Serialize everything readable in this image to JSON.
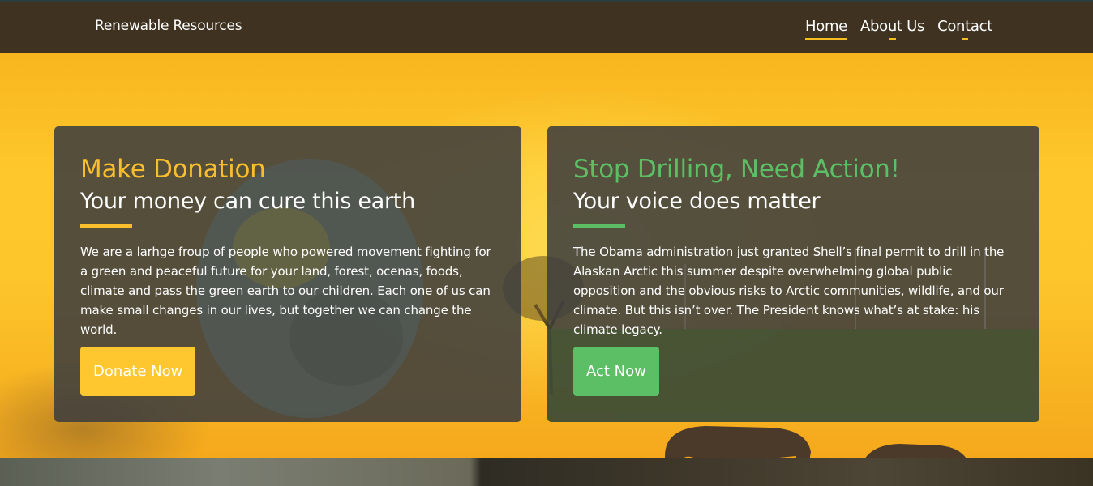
{
  "nav": {
    "brand": "Renewable Resources",
    "links": [
      {
        "label": "Home",
        "active": true
      },
      {
        "label": "About Us",
        "active": false
      },
      {
        "label": "Contact",
        "active": false
      }
    ]
  },
  "cards": {
    "donation": {
      "title": "Make Donation",
      "subtitle": "Your money can cure this earth",
      "body": "We are a larhge froup of people who powered movement fighting for a green and peaceful future for your land, forest, ocenas, foods, climate and pass the green earth to our children. Each one of us can make small changes in our lives, but together we can change the world.",
      "button": "Donate Now"
    },
    "drilling": {
      "title": "Stop Drilling, Need Action!",
      "subtitle": "Your voice does matter",
      "body": "The Obama administration just granted Shell’s final permit to drill in the Alaskan Arctic this summer despite overwhelming global public opposition and the obvious risks to Arctic communities, wildlife, and our climate. But this isn’t over. The President knows what’s at stake: his climate legacy.",
      "button": "Act Now"
    }
  },
  "colors": {
    "nav_bg": "#3f3221",
    "accent_yellow": "#f9be2c",
    "accent_green": "#5cbf66",
    "card_bg": "#3e3e3e"
  }
}
